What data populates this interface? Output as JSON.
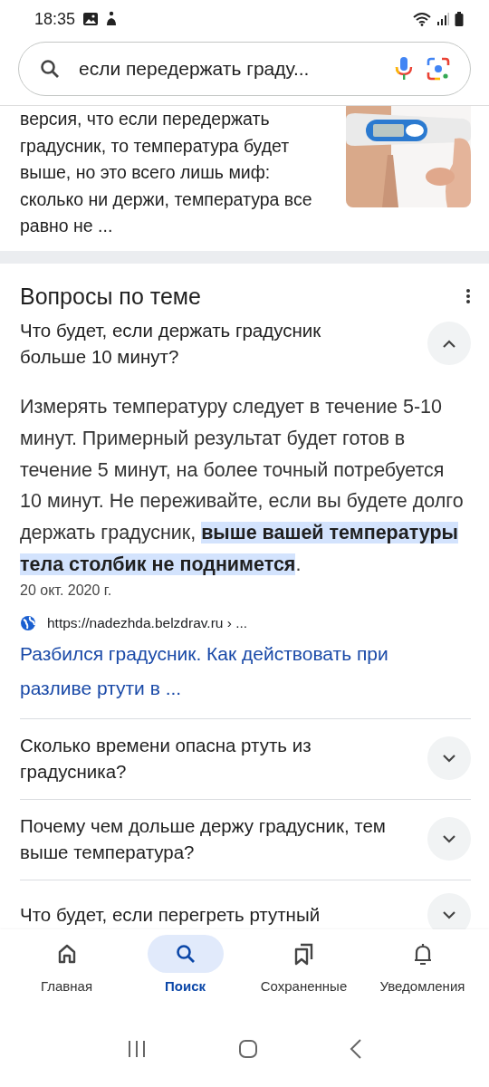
{
  "status_bar": {
    "time": "18:35"
  },
  "search": {
    "value": "если передержать граду..."
  },
  "snippet": {
    "text": "версия, что если передержать градусник, то температура будет выше, но это всего лишь миф: сколько ни держи, температура все равно не ..."
  },
  "related_questions": {
    "title": "Вопросы по теме",
    "items": [
      {
        "question": "Что будет, если держать градусник больше 10 минут?",
        "expanded": true,
        "answer": "Измерять температуру следует в течение 5-10 минут. Примерный результат будет готов в течение 5 минут, на более точный потребуется 10 минут. Не переживайте, если вы будете долго держать градусник, **выше вашей температуры тела столбик не поднимется**.",
        "date": "20 окт. 2020 г.",
        "source_url": "https://nadezhda.belzdrav.ru › ...",
        "link_title": "Разбился градусник. Как действовать при разливе ртути в ..."
      },
      {
        "question": "Сколько времени опасна ртуть из градусника?",
        "expanded": false
      },
      {
        "question": "Почему чем дольше держу градусник, тем выше температура?",
        "expanded": false
      },
      {
        "question": "Что будет, если перегреть ртутный",
        "expanded": false
      }
    ]
  },
  "bottom_nav": [
    {
      "label": "Главная",
      "kind": "home",
      "selected": false
    },
    {
      "label": "Поиск",
      "kind": "search",
      "selected": true
    },
    {
      "label": "Сохраненные",
      "kind": "saved",
      "selected": false
    },
    {
      "label": "Уведомления",
      "kind": "bell",
      "selected": false
    }
  ]
}
